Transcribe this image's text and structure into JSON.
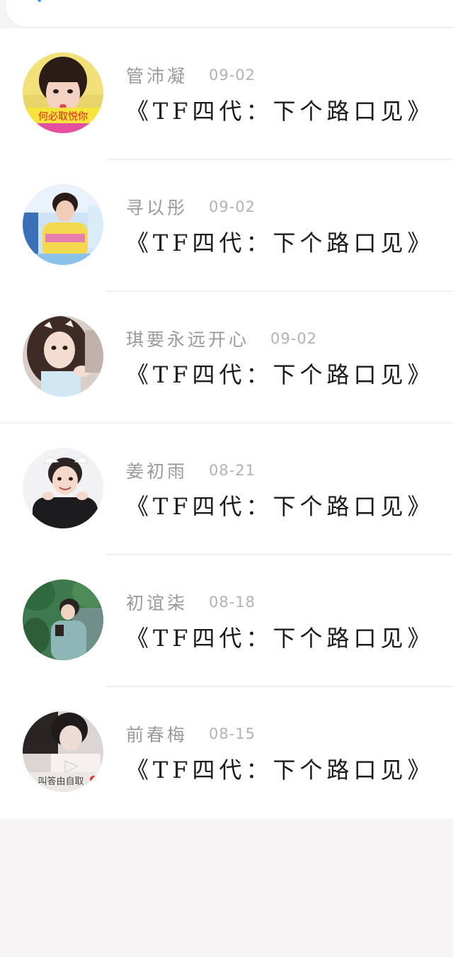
{
  "header": {
    "back_icon": "back-arrow-icon"
  },
  "colors": {
    "page_bg": "#f6f4f4",
    "card_bg": "#ffffff",
    "name_color": "#9a9a9a",
    "date_color": "#b2b2b2",
    "title_color": "#1b1b1b",
    "accent_blue": "#2f8fff"
  },
  "items": [
    {
      "name": "管沛凝",
      "date": "09-02",
      "title": "《TF四代：下个路口见》",
      "avatar_overlay_text": "何必取悦你"
    },
    {
      "name": "寻以彤",
      "date": "09-02",
      "title": "《TF四代：下个路口见》"
    },
    {
      "name": "琪要永远开心",
      "date": "09-02",
      "title": "《TF四代：下个路口见》"
    },
    {
      "name": "姜初雨",
      "date": "08-21",
      "title": "《TF四代：下个路口见》"
    },
    {
      "name": "初谊柒",
      "date": "08-18",
      "title": "《TF四代：下个路口见》"
    },
    {
      "name": "前春梅",
      "date": "08-15",
      "title": "《TF四代：下个路口见》",
      "avatar_overlay_text": "叫答由自取"
    }
  ]
}
